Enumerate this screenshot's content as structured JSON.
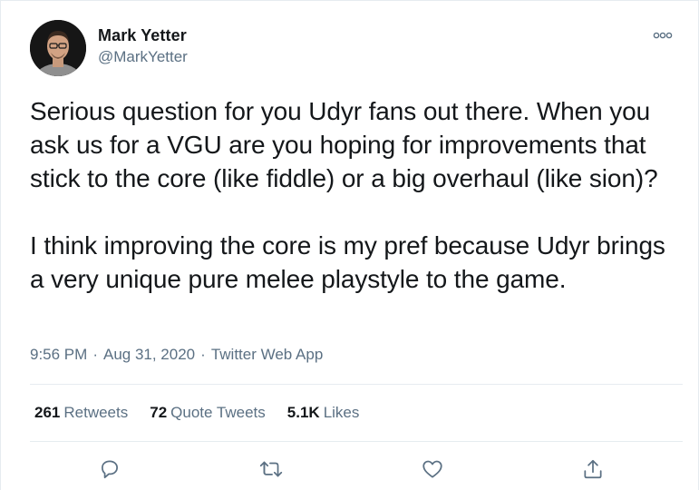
{
  "author": {
    "name": "Mark Yetter",
    "handle": "@MarkYetter"
  },
  "tweet": {
    "text": "Serious question for you Udyr fans out there. When you ask us for a VGU are you hoping for improvements that stick to the core (like fiddle) or a big overhaul (like sion)?\n\nI think improving the core is my pref because Udyr brings a very unique pure melee playstyle to the game.",
    "time": "9:56 PM",
    "separator": "·",
    "date": "Aug 31, 2020",
    "source": "Twitter Web App"
  },
  "stats": {
    "retweets_count": "261",
    "retweets_label": "Retweets",
    "quotes_count": "72",
    "quotes_label": "Quote Tweets",
    "likes_count": "5.1K",
    "likes_label": "Likes"
  },
  "icons": {
    "more": "more-icon",
    "reply": "reply-icon",
    "retweet": "retweet-icon",
    "like": "like-icon",
    "share": "share-icon"
  },
  "colors": {
    "text": "#14171a",
    "secondary": "#5b7083",
    "divider": "#e6ecf0"
  }
}
